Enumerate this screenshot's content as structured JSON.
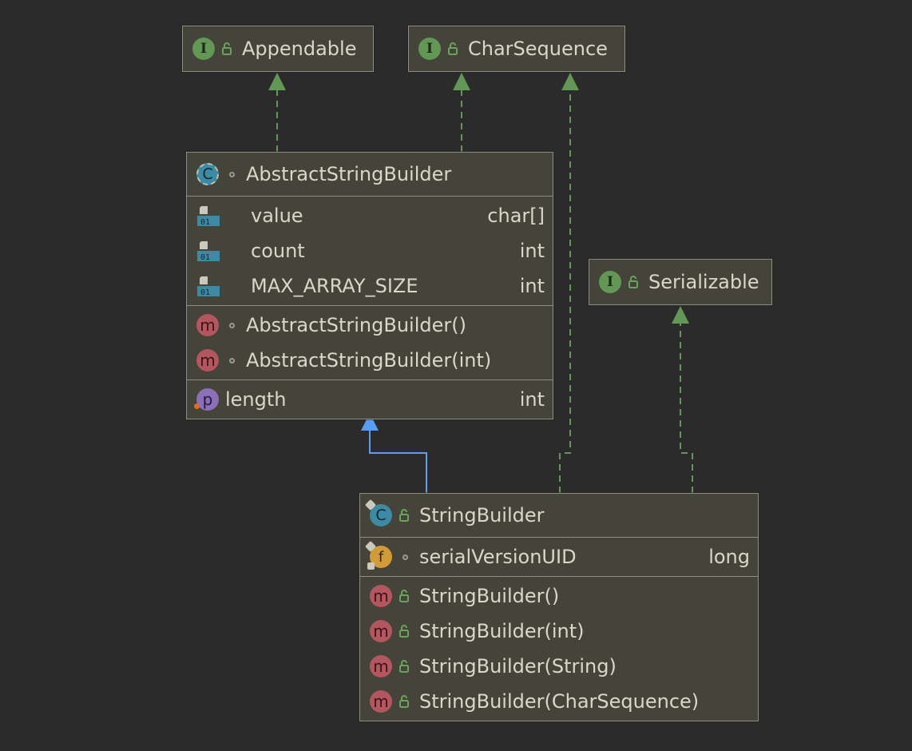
{
  "colors": {
    "background": "#2b2b2b",
    "node_fill": "#45443a",
    "node_border": "#8d8d80",
    "implements_edge": "#629755",
    "extends_edge": "#589df6",
    "interface_icon": "#629755",
    "class_icon": "#3c8aa3",
    "method_icon": "#b3565f",
    "property_icon": "#8b6fb8",
    "final_field_icon": "#d19b3a"
  },
  "nodes": {
    "appendable": {
      "icon": "interface-icon",
      "glyph": "I",
      "visibility": "public-lock-icon",
      "name": "Appendable"
    },
    "charsequence": {
      "icon": "interface-icon",
      "glyph": "I",
      "visibility": "public-lock-icon",
      "name": "CharSequence"
    },
    "serializable": {
      "icon": "interface-icon",
      "glyph": "I",
      "visibility": "public-lock-icon",
      "name": "Serializable"
    },
    "abstract_string_builder": {
      "icon": "abstract-class-icon",
      "glyph": "C",
      "visibility": "package-private-icon",
      "name": "AbstractStringBuilder",
      "fields": [
        {
          "icon": "field-icon",
          "name": "value",
          "type": "char[]"
        },
        {
          "icon": "field-icon",
          "name": "count",
          "type": "int"
        },
        {
          "icon": "field-icon",
          "name": "MAX_ARRAY_SIZE",
          "type": "int"
        }
      ],
      "methods": [
        {
          "icon": "method-icon",
          "glyph": "m",
          "visibility": "package-private-icon",
          "name": "AbstractStringBuilder()"
        },
        {
          "icon": "method-icon",
          "glyph": "m",
          "visibility": "package-private-icon",
          "name": "AbstractStringBuilder(int)"
        }
      ],
      "properties": [
        {
          "icon": "property-icon",
          "glyph": "p",
          "name": "length",
          "type": "int"
        }
      ]
    },
    "string_builder": {
      "icon": "final-class-icon",
      "glyph": "C",
      "visibility": "public-lock-icon",
      "name": "StringBuilder",
      "fields": [
        {
          "icon": "final-static-field-icon",
          "glyph": "f",
          "visibility": "package-private-icon",
          "name": "serialVersionUID",
          "type": "long"
        }
      ],
      "methods": [
        {
          "icon": "method-icon",
          "glyph": "m",
          "visibility": "public-lock-icon",
          "name": "StringBuilder()"
        },
        {
          "icon": "method-icon",
          "glyph": "m",
          "visibility": "public-lock-icon",
          "name": "StringBuilder(int)"
        },
        {
          "icon": "method-icon",
          "glyph": "m",
          "visibility": "public-lock-icon",
          "name": "StringBuilder(String)"
        },
        {
          "icon": "method-icon",
          "glyph": "m",
          "visibility": "public-lock-icon",
          "name": "StringBuilder(CharSequence)"
        }
      ]
    }
  },
  "edges": [
    {
      "from": "abstract_string_builder",
      "to": "appendable",
      "kind": "implements"
    },
    {
      "from": "abstract_string_builder",
      "to": "charsequence",
      "kind": "implements"
    },
    {
      "from": "string_builder",
      "to": "charsequence",
      "kind": "implements"
    },
    {
      "from": "string_builder",
      "to": "serializable",
      "kind": "implements"
    },
    {
      "from": "string_builder",
      "to": "abstract_string_builder",
      "kind": "extends"
    }
  ]
}
